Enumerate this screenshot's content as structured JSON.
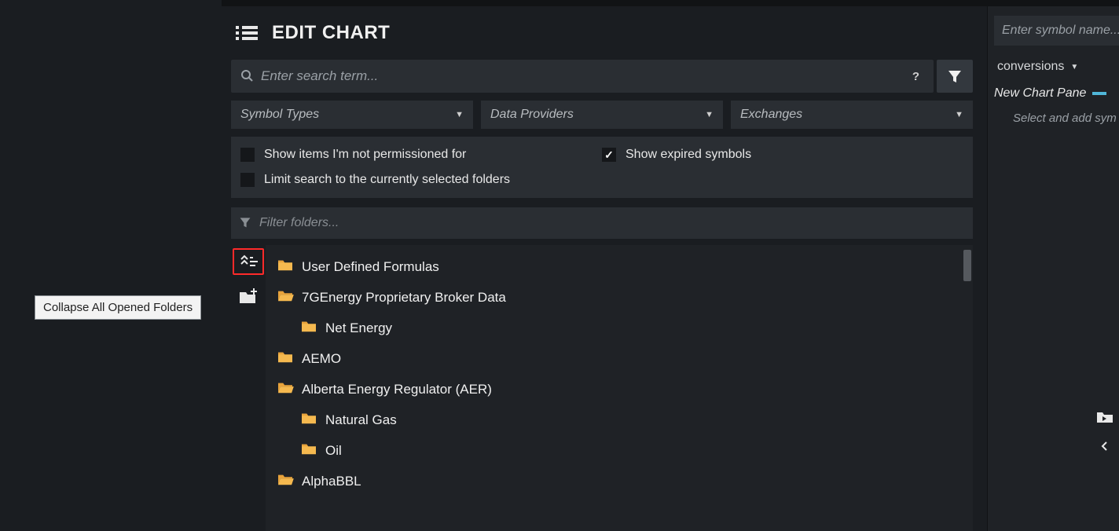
{
  "header": {
    "title": "EDIT CHART"
  },
  "search": {
    "placeholder": "Enter search term...",
    "help": "?"
  },
  "dropdowns": {
    "symbol_types": "Symbol Types",
    "data_providers": "Data Providers",
    "exchanges": "Exchanges"
  },
  "checks": {
    "not_permissioned": "Show items I'm not permissioned for",
    "expired": "Show expired symbols",
    "limit_folders": "Limit search to the currently selected folders"
  },
  "filter_folders": {
    "placeholder": "Filter folders..."
  },
  "tooltip": "Collapse All Opened Folders",
  "tree": [
    {
      "label": "User Defined Formulas",
      "level": 1,
      "open": false
    },
    {
      "label": "7GEnergy Proprietary Broker Data",
      "level": 1,
      "open": true
    },
    {
      "label": "Net Energy",
      "level": 2,
      "open": false
    },
    {
      "label": "AEMO",
      "level": 1,
      "open": false
    },
    {
      "label": "Alberta Energy Regulator (AER)",
      "level": 1,
      "open": true
    },
    {
      "label": "Natural Gas",
      "level": 2,
      "open": false
    },
    {
      "label": "Oil",
      "level": 2,
      "open": false
    },
    {
      "label": "AlphaBBL",
      "level": 1,
      "open": true
    }
  ],
  "right": {
    "symbol_placeholder": "Enter symbol name...",
    "conversions": "conversions",
    "new_pane": "New Chart Pane",
    "hint": "Select and add sym"
  }
}
